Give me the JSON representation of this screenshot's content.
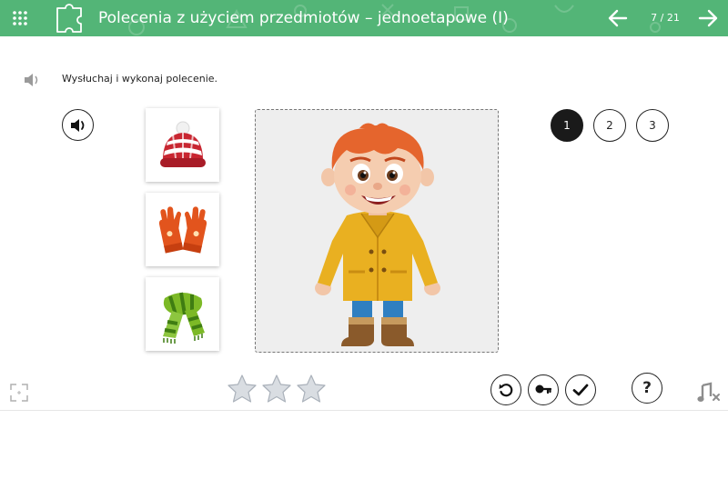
{
  "header": {
    "title": "Polecenia z użyciem przedmiotów – jednoetapowe (I)",
    "counter": "7 / 21",
    "color": "#53b577"
  },
  "instruction": {
    "text": "Wysłuchaj i wykonaj polecenie."
  },
  "items": [
    {
      "icon": "winter-hat-icon"
    },
    {
      "icon": "gloves-icon"
    },
    {
      "icon": "scarf-icon"
    }
  ],
  "steps": [
    {
      "label": "1",
      "active": true
    },
    {
      "label": "2",
      "active": false
    },
    {
      "label": "3",
      "active": false
    }
  ],
  "help": {
    "label": "?"
  },
  "stars": {
    "earned": 0,
    "total": 3
  }
}
